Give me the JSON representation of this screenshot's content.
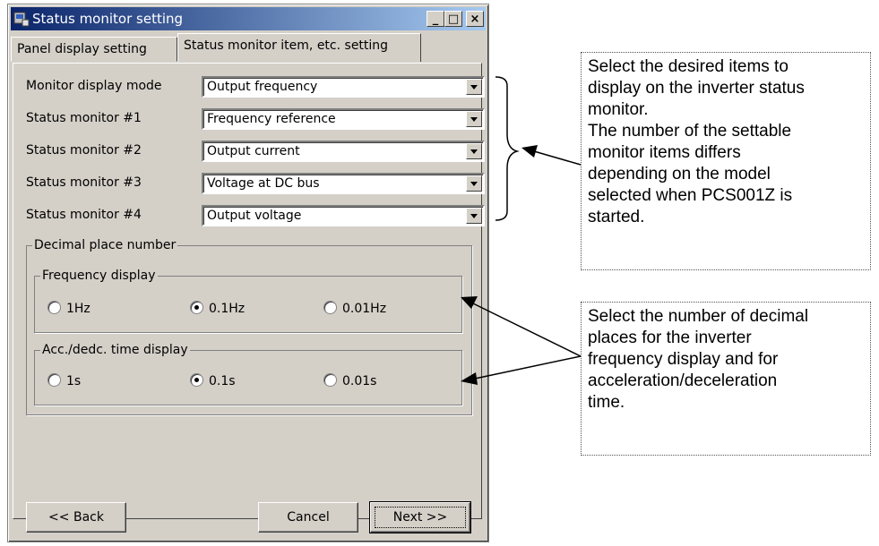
{
  "window": {
    "title": "Status monitor setting",
    "controls": [
      "_",
      "□",
      "×"
    ]
  },
  "tabs": [
    {
      "label": "Panel display setting",
      "active": false
    },
    {
      "label": "Status monitor item, etc. setting",
      "active": true
    }
  ],
  "monitor_rows": [
    {
      "label": "Monitor display mode",
      "value": "Output frequency"
    },
    {
      "label": "Status monitor #1",
      "value": "Frequency reference"
    },
    {
      "label": "Status monitor #2",
      "value": "Output current"
    },
    {
      "label": "Status monitor #3",
      "value": "Voltage at DC bus"
    },
    {
      "label": "Status monitor #4",
      "value": "Output voltage"
    }
  ],
  "decimal_group": {
    "title": "Decimal place number",
    "frequency": {
      "title": "Frequency display",
      "options": [
        "1Hz",
        "0.1Hz",
        "0.01Hz"
      ],
      "selected": "0.1Hz"
    },
    "acc_dec": {
      "title": "Acc./dedc. time display",
      "options": [
        "1s",
        "0.1s",
        "0.01s"
      ],
      "selected": "0.1s"
    }
  },
  "buttons": {
    "back": "<< Back",
    "cancel": "Cancel",
    "next": "Next >>"
  },
  "annotations": {
    "note1": "Select the desired items to\ndisplay on the inverter status\nmonitor.\nThe number of the settable\nmonitor items differs\ndepending on the model\nselected when PCS001Z is\nstarted.",
    "note2": "Select the number of decimal\nplaces for the inverter\nfrequency display and for\nacceleration/deceleration\ntime."
  },
  "colors": {
    "window_face": "#d4d0c8",
    "title_start": "#0a246a",
    "title_end": "#a6caf0"
  }
}
